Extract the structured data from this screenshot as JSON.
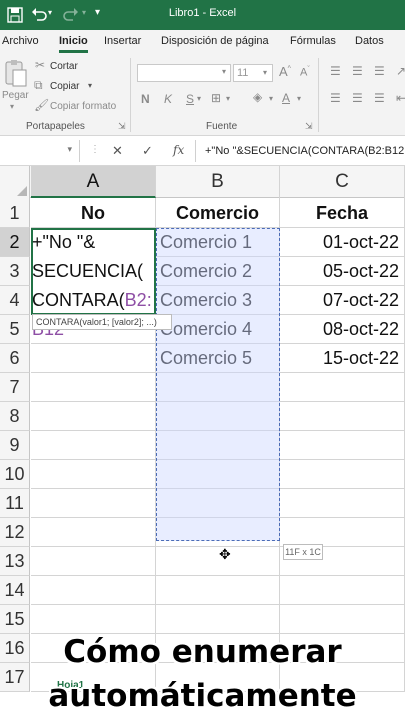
{
  "window": {
    "title": "Libro1 - Excel"
  },
  "ribbon": {
    "tabs": [
      "Archivo",
      "Inicio",
      "Insertar",
      "Disposición de página",
      "Fórmulas",
      "Datos"
    ],
    "active_tab": "Inicio",
    "clipboard": {
      "paste_label": "Pegar",
      "cut_label": "Cortar",
      "copy_label": "Copiar",
      "format_painter_label": "Copiar formato",
      "group_label": "Portapapeles"
    },
    "font": {
      "size_value": "11",
      "group_label": "Fuente",
      "bold": "N",
      "italic": "K",
      "underline": "S"
    }
  },
  "formula_bar": {
    "cancel_glyph": "✕",
    "enter_glyph": "✓",
    "fx_label": "fx",
    "formula": "+\"No \"&SECUENCIA(CONTARA(B2:B12"
  },
  "sheet": {
    "columns": [
      "A",
      "B",
      "C"
    ],
    "rows": [
      "1",
      "2",
      "3",
      "4",
      "5",
      "6",
      "7",
      "8",
      "9",
      "10",
      "11",
      "12",
      "13",
      "14",
      "15",
      "16",
      "17"
    ],
    "headers": {
      "a": "No",
      "b": "Comercio",
      "c": "Fecha"
    },
    "data": [
      {
        "b": "Comercio 1",
        "c": "01-oct-22"
      },
      {
        "b": "Comercio 2",
        "c": "05-oct-22"
      },
      {
        "b": "Comercio 3",
        "c": "07-oct-22"
      },
      {
        "b": "Comercio 4",
        "c": "08-oct-22"
      },
      {
        "b": "Comercio 5",
        "c": "15-oct-22"
      }
    ],
    "edit_lines": [
      "+\"No \"&",
      "SECUENCIA(",
      "CONTARA("
    ],
    "edit_ref": "B2:",
    "edit_overflow": "B12",
    "tooltip": "CONTARA(valor1; [valor2]; ...)",
    "size_tip": "11F x 1C",
    "sheet_tab": "Hoja1"
  },
  "caption": {
    "line1": "Cómo enumerar",
    "line2": "automáticamente"
  },
  "colors": {
    "excel_green": "#217346",
    "ref_purple": "#8e4fa5",
    "ref_blue": "#4b6cb7"
  }
}
